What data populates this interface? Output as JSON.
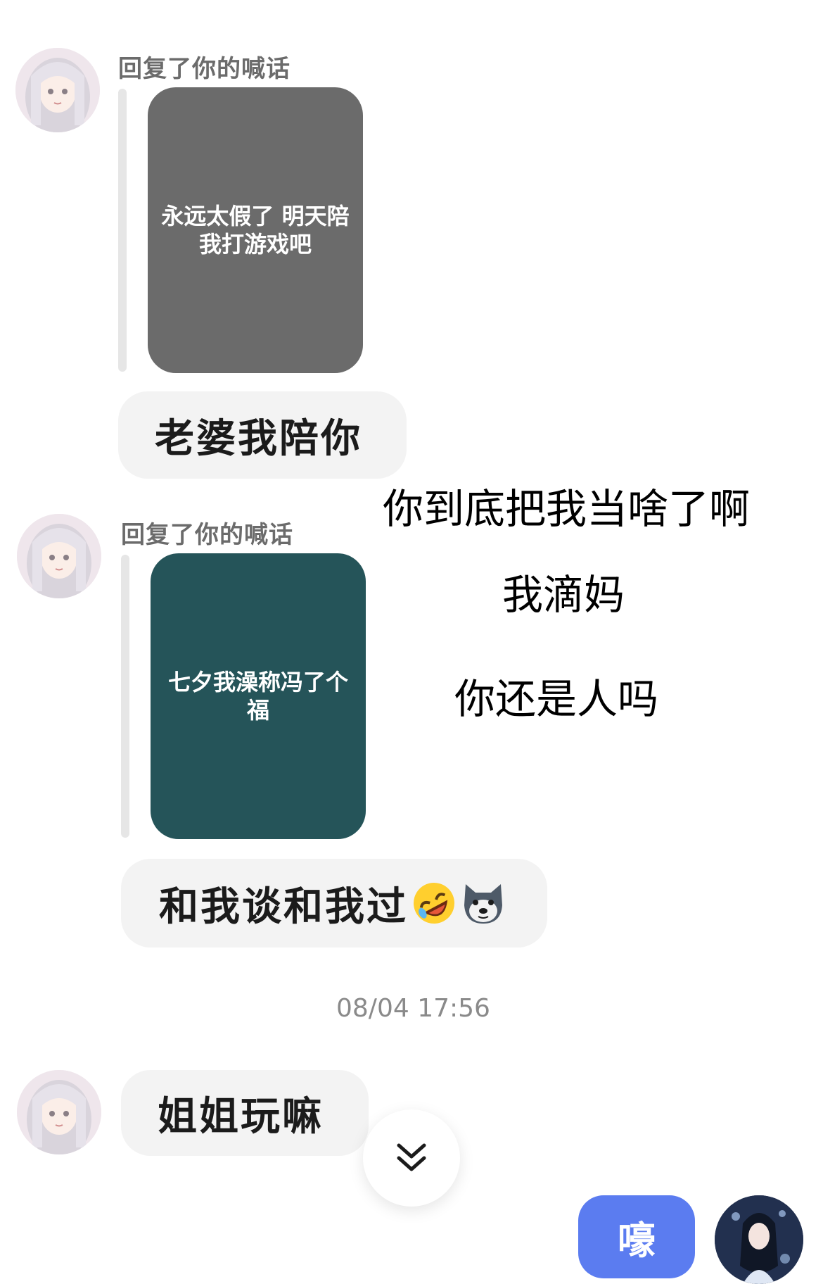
{
  "messages": [
    {
      "reply_label": "回复了你的喊话",
      "quote_text": "永远太假了 明天陪\n我打游戏吧",
      "quote_color": "#6b6b6b",
      "text": "老婆我陪你"
    },
    {
      "reply_label": "回复了你的喊话",
      "quote_text": "七夕我澡称冯了个\n福",
      "quote_color": "#255459",
      "text": "和我谈和我过",
      "emojis": [
        "rolling-laughing-emoji",
        "husky-dog-emoji"
      ]
    }
  ],
  "overlay_captions": [
    "你到底把我当啥了啊",
    "我滴妈",
    "你还是人吗"
  ],
  "timestamp": "08/04 17:56",
  "last_message": {
    "text": "姐姐玩嘛"
  },
  "scroll_button": {
    "icon": "double-chevron-down-icon"
  },
  "send_button": {
    "label": "嚎",
    "color": "#5b7cf0"
  },
  "colors": {
    "bubble": "#f3f3f3",
    "accent": "#5b7cf0"
  }
}
